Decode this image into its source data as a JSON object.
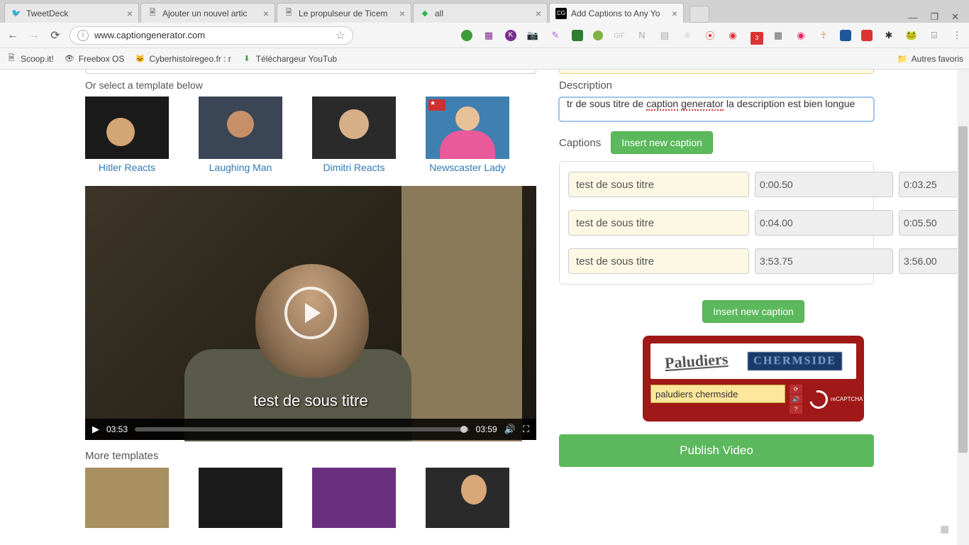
{
  "browser": {
    "tabs": [
      {
        "title": "TweetDeck",
        "icon_color": "#1da1f2"
      },
      {
        "title": "Ajouter un nouvel artic",
        "icon_color": "#888"
      },
      {
        "title": "Le propulseur de Ticem",
        "icon_color": "#888"
      },
      {
        "title": "all",
        "icon_color": "#2bb24c"
      },
      {
        "title": "Add Captions to Any Yo",
        "icon_color": "#000",
        "active": true
      }
    ],
    "url": "www.captiongenerator.com",
    "bookmarks": [
      {
        "label": "Scoop.it!"
      },
      {
        "label": "Freebox OS"
      },
      {
        "label": "Cyberhistoiregeo.fr : r"
      },
      {
        "label": "Téléchargeur YouTub"
      }
    ],
    "other_bookmarks": "Autres favoris"
  },
  "page": {
    "template_prompt": "Or select a template below",
    "templates": [
      {
        "name": "Hitler Reacts"
      },
      {
        "name": "Laughing Man"
      },
      {
        "name": "Dimitri Reacts"
      },
      {
        "name": "Newscaster Lady"
      }
    ],
    "video": {
      "subtitle": "test de sous titre",
      "time_current": "03:53",
      "time_total": "03:59"
    },
    "more_templates_label": "More templates",
    "right": {
      "description_label": "Description",
      "description_value": "tr de sous titre de caption generator la description est bien longue",
      "captions_label": "Captions",
      "insert_btn": "Insert new caption",
      "rows": [
        {
          "text": "test de sous titre",
          "start": "0:00.50",
          "end": "0:03.25"
        },
        {
          "text": "test de sous titre",
          "start": "0:04.00",
          "end": "0:05.50"
        },
        {
          "text": "test de sous titre",
          "start": "3:53.75",
          "end": "3:56.00"
        }
      ],
      "insert_btn2": "Insert new caption",
      "captcha": {
        "word1": "Paludiers",
        "word2": "CHERMSIDE",
        "input": "paludiers chermside",
        "logo": "reCAPTCHA™"
      },
      "publish": "Publish Video"
    }
  }
}
